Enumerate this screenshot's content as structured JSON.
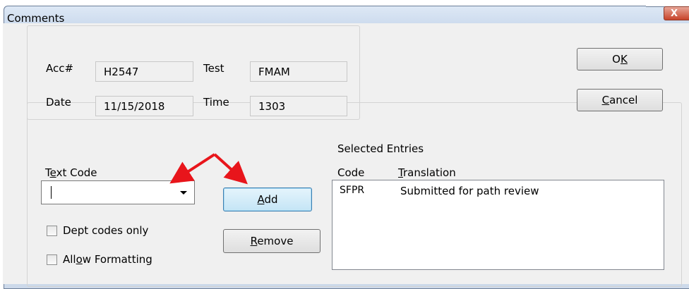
{
  "window": {
    "title": "Comments",
    "close_glyph": "X"
  },
  "info": {
    "acc_label": "Acc#",
    "acc_value": "H2547",
    "test_label": "Test",
    "test_value": "FMAM",
    "date_label": "Date",
    "date_value": "11/15/2018",
    "time_label": "Time",
    "time_value": "1303"
  },
  "buttons": {
    "ok": "OK",
    "cancel": "Cancel",
    "add": "Add",
    "remove": "Remove"
  },
  "text_code": {
    "label": "Text Code",
    "value": ""
  },
  "checkboxes": {
    "dept_codes_only": "Dept codes only",
    "allow_formatting": "Allow Formatting"
  },
  "selected_entries": {
    "title": "Selected Entries",
    "columns": [
      "Code",
      "Translation"
    ],
    "rows": [
      {
        "code": "SFPR",
        "translation": "Submitted for path review"
      }
    ]
  },
  "colors": {
    "annotation_arrow": "#e8151b"
  },
  "icons": {
    "close": "close-icon",
    "dropdown": "chevron-down-icon"
  }
}
